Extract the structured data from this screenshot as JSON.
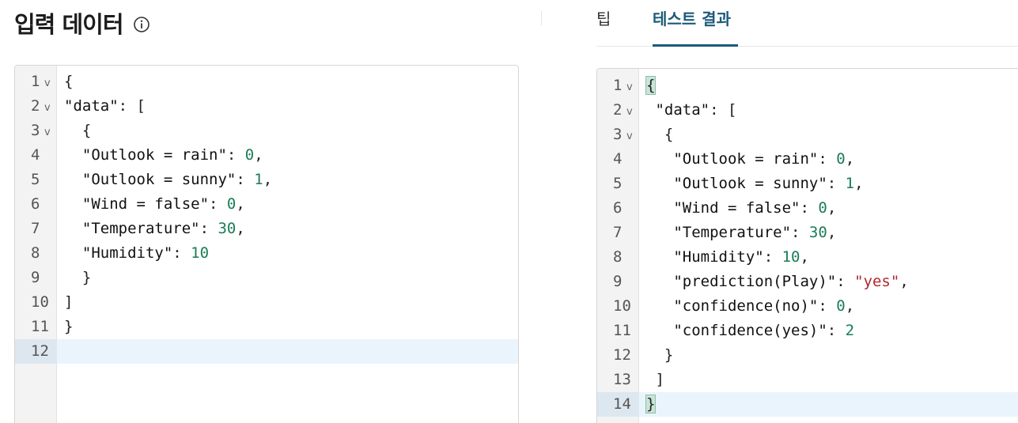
{
  "input_panel": {
    "title": "입력 데이터",
    "info_icon": "info-circle-icon"
  },
  "tabs": {
    "tip": "팁",
    "result": "테스트 결과",
    "active": "result"
  },
  "input_editor": {
    "lines": [
      {
        "num": "1",
        "fold": true
      },
      {
        "num": "2",
        "fold": true
      },
      {
        "num": "3",
        "fold": true
      },
      {
        "num": "4",
        "fold": false
      },
      {
        "num": "5",
        "fold": false
      },
      {
        "num": "6",
        "fold": false
      },
      {
        "num": "7",
        "fold": false
      },
      {
        "num": "8",
        "fold": false
      },
      {
        "num": "9",
        "fold": false
      },
      {
        "num": "10",
        "fold": false
      },
      {
        "num": "11",
        "fold": false
      },
      {
        "num": "12",
        "fold": false
      }
    ],
    "active_line": "12",
    "tokens": {
      "l1": "{",
      "l2_key": "\"data\"",
      "l2_rest": ": [",
      "l3": "  {",
      "l4_key": "  \"Outlook = rain\"",
      "l4_val": "0",
      "l5_key": "  \"Outlook = sunny\"",
      "l5_val": "1",
      "l6_key": "  \"Wind = false\"",
      "l6_val": "0",
      "l7_key": "  \"Temperature\"",
      "l7_val": "30",
      "l8_key": "  \"Humidity\"",
      "l8_val": "10",
      "l9": "  }",
      "l10": "]",
      "l11": "}"
    }
  },
  "result_editor": {
    "lines": [
      {
        "num": "1",
        "fold": true
      },
      {
        "num": "2",
        "fold": true
      },
      {
        "num": "3",
        "fold": true
      },
      {
        "num": "4",
        "fold": false
      },
      {
        "num": "5",
        "fold": false
      },
      {
        "num": "6",
        "fold": false
      },
      {
        "num": "7",
        "fold": false
      },
      {
        "num": "8",
        "fold": false
      },
      {
        "num": "9",
        "fold": false
      },
      {
        "num": "10",
        "fold": false
      },
      {
        "num": "11",
        "fold": false
      },
      {
        "num": "12",
        "fold": false
      },
      {
        "num": "13",
        "fold": false
      },
      {
        "num": "14",
        "fold": false
      }
    ],
    "active_line": "14",
    "tokens": {
      "l1": "{",
      "l2_key": " \"data\"",
      "l2_rest": ": [",
      "l3": "  {",
      "l4_key": "   \"Outlook = rain\"",
      "l4_val": "0",
      "l5_key": "   \"Outlook = sunny\"",
      "l5_val": "1",
      "l6_key": "   \"Wind = false\"",
      "l6_val": "0",
      "l7_key": "   \"Temperature\"",
      "l7_val": "30",
      "l8_key": "   \"Humidity\"",
      "l8_val": "10",
      "l9_key": "   \"prediction(Play)\"",
      "l9_val": "\"yes\"",
      "l10_key": "   \"confidence(no)\"",
      "l10_val": "0",
      "l11_key": "   \"confidence(yes)\"",
      "l11_val": "2",
      "l12": "  }",
      "l13": " ]",
      "l14": "}"
    }
  },
  "colors": {
    "number": "#1b7c55",
    "string": "#b1272e",
    "active_tab": "#1b5a7a"
  }
}
